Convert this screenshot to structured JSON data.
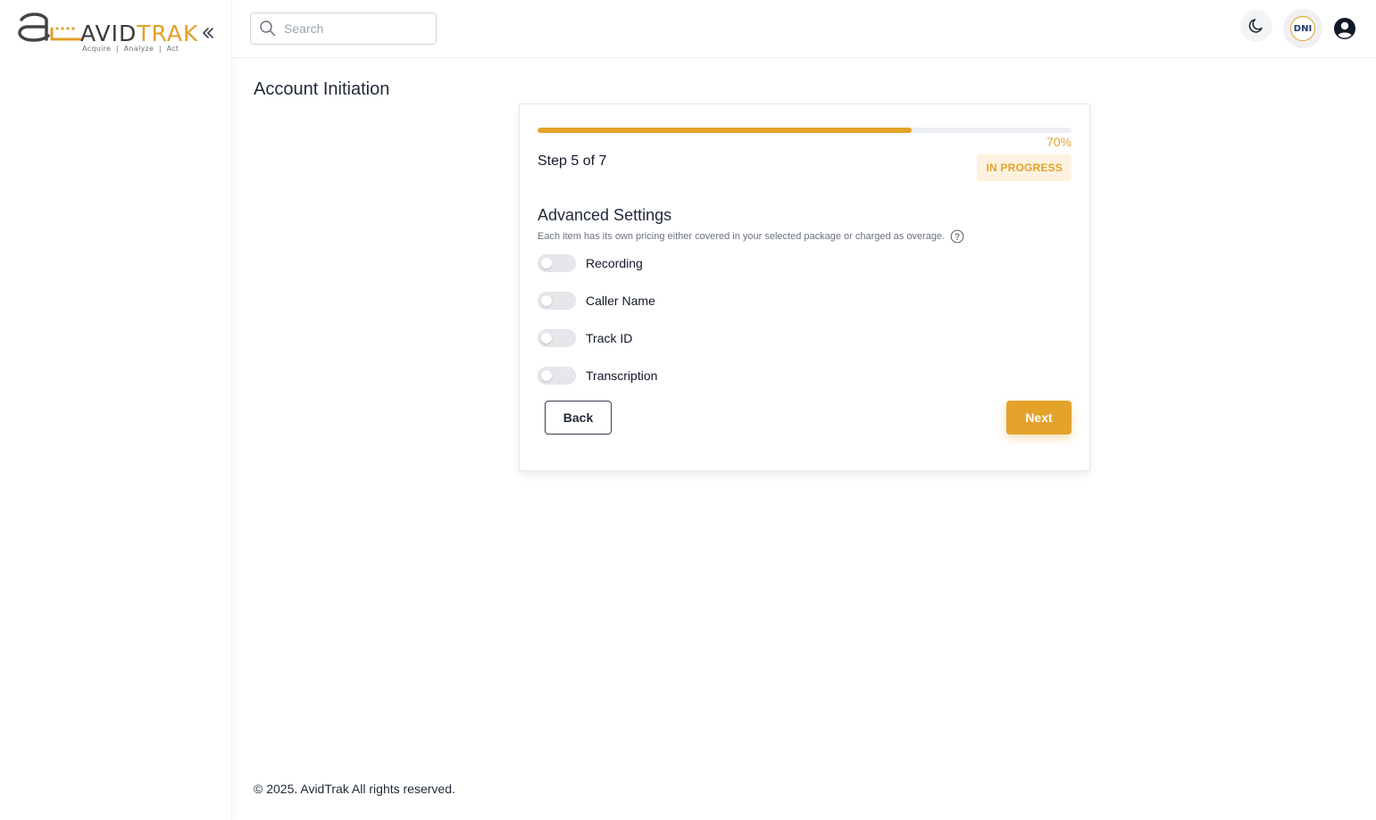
{
  "brand": {
    "name_part1": "AVID",
    "name_part2": "TRAK",
    "tagline": "Acquire  |  Analyze  |  Act",
    "accent_color": "#e3a32b"
  },
  "header": {
    "search_placeholder": "Search",
    "search_value": "",
    "avatar_initials": "DNI",
    "icons": [
      "search-icon",
      "moon-icon",
      "user-circle-icon",
      "chevrons-left-icon"
    ]
  },
  "page": {
    "title": "Account Initiation"
  },
  "wizard": {
    "progress_percent": 70,
    "progress_label": "70%",
    "step_label": "Step 5 of 7",
    "status": "IN PROGRESS",
    "section_title": "Advanced Settings",
    "section_description": "Each item has its own pricing either covered in your selected package or charged as overage.",
    "options": [
      {
        "label": "Recording",
        "enabled": false
      },
      {
        "label": "Caller Name",
        "enabled": false
      },
      {
        "label": "Track ID",
        "enabled": false
      },
      {
        "label": "Transcription",
        "enabled": false
      }
    ],
    "back_label": "Back",
    "next_label": "Next"
  },
  "footer": {
    "copyright": "© 2025. AvidTrak All rights reserved."
  }
}
